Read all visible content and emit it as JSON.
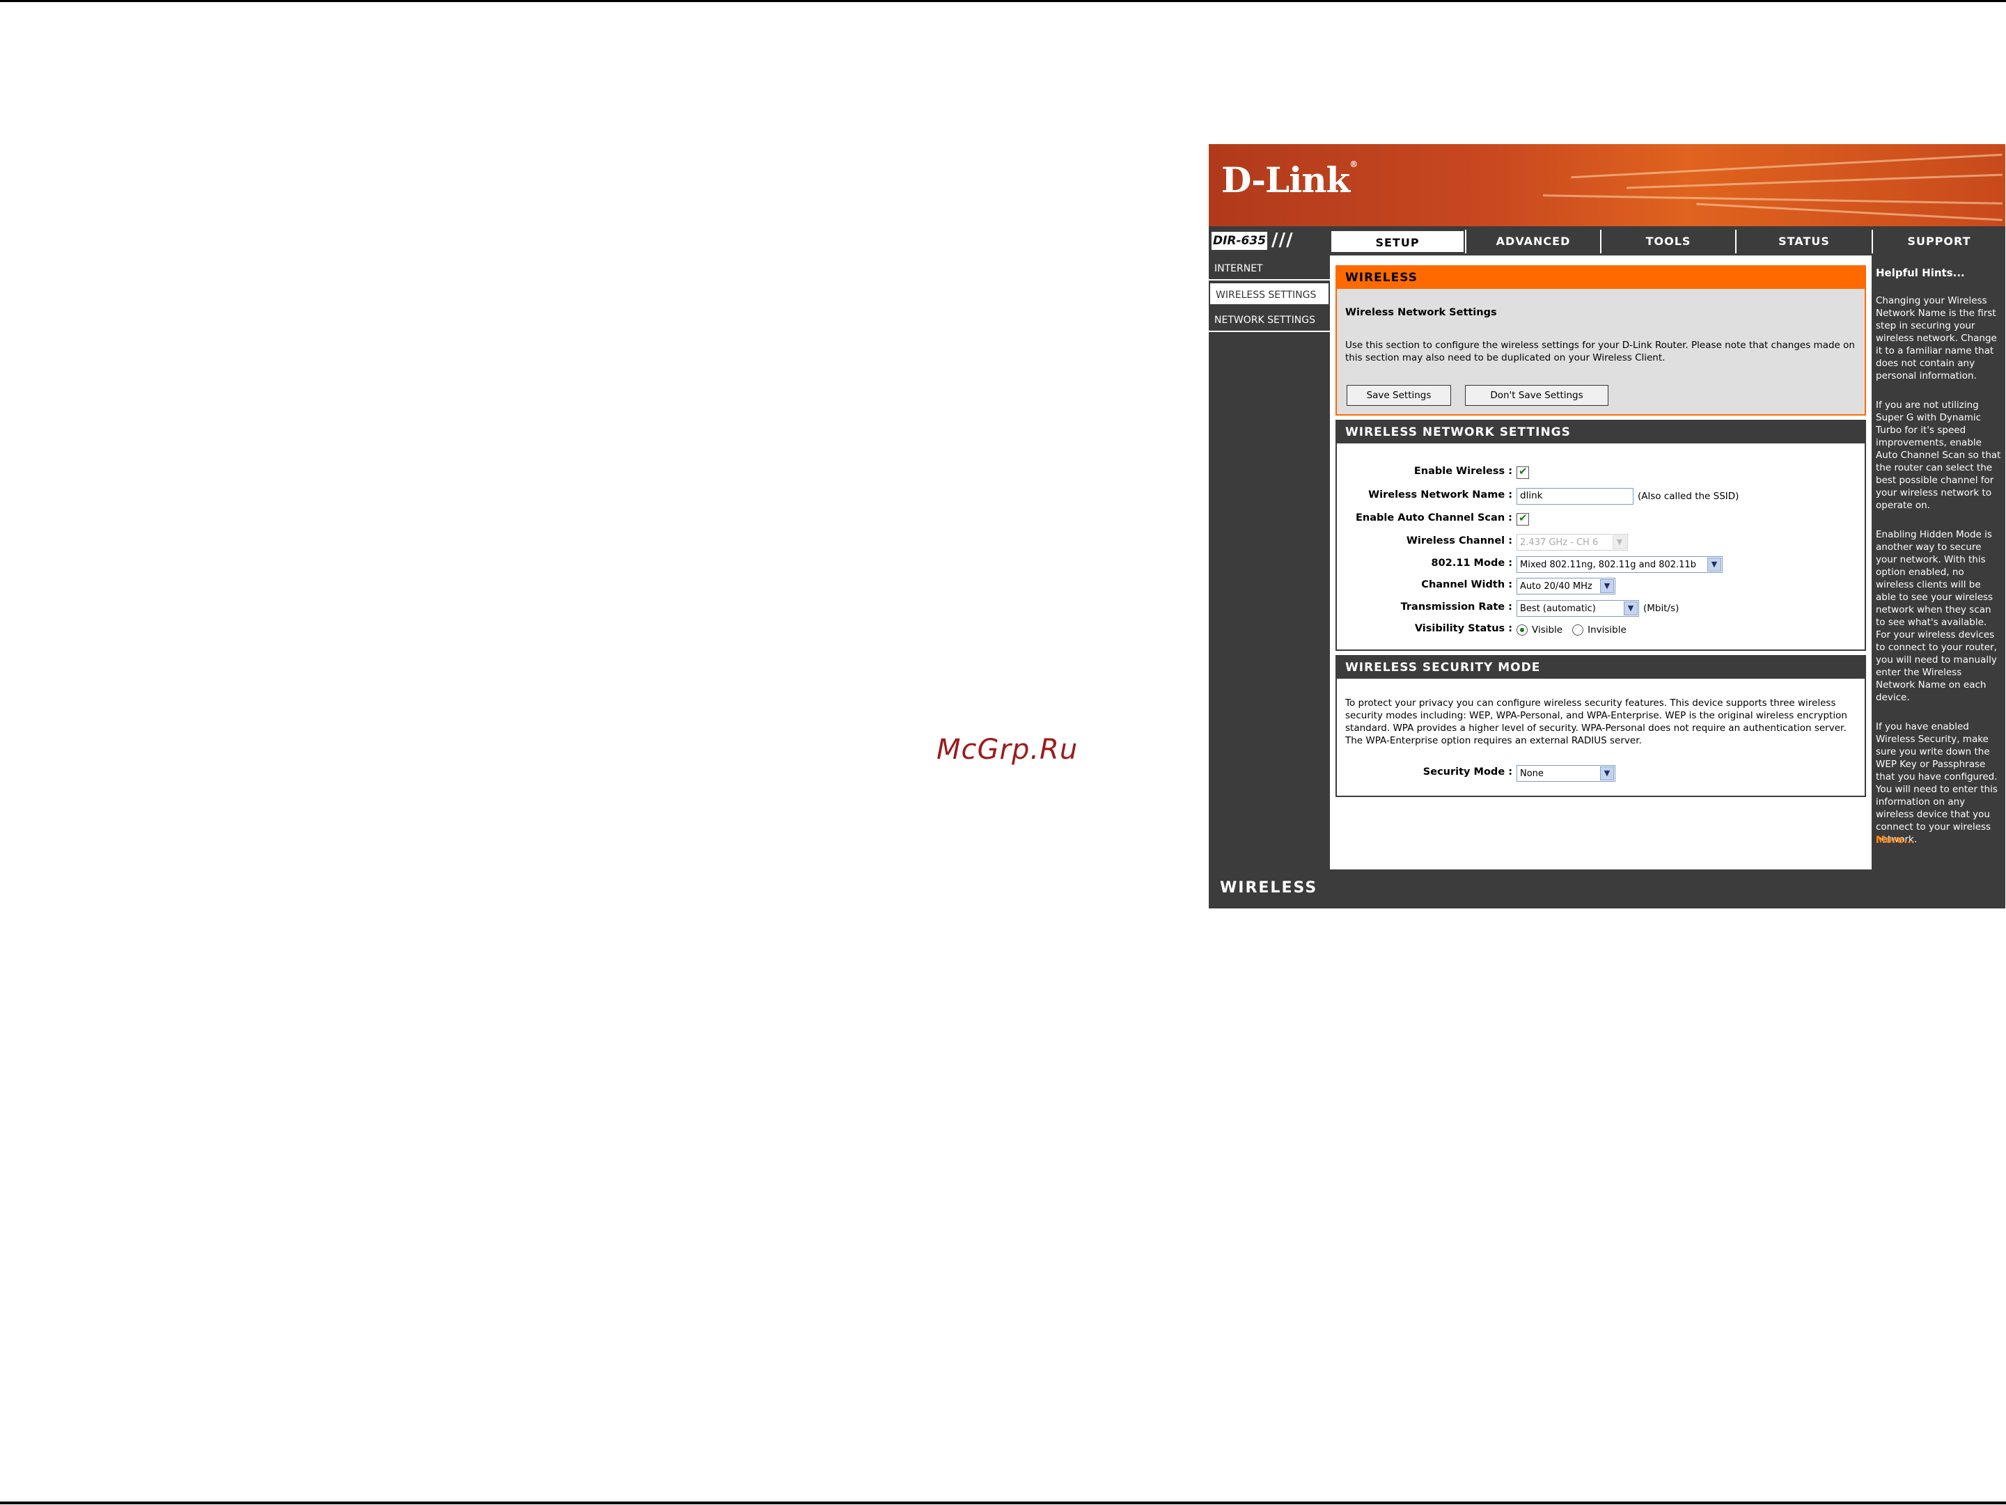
{
  "watermark": "McGrp.Ru",
  "brand": {
    "logo": "D-Link",
    "model": "DIR-635",
    "footer_label": "WIRELESS"
  },
  "tabs": [
    {
      "label": "SETUP",
      "active": true
    },
    {
      "label": "ADVANCED",
      "active": false
    },
    {
      "label": "TOOLS",
      "active": false
    },
    {
      "label": "STATUS",
      "active": false
    },
    {
      "label": "SUPPORT",
      "active": false
    }
  ],
  "sidebar": {
    "items": [
      {
        "label": "INTERNET",
        "active": false
      },
      {
        "label": "WIRELESS SETTINGS",
        "active": true
      },
      {
        "label": "NETWORK SETTINGS",
        "active": false
      }
    ]
  },
  "intro": {
    "header": "WIRELESS",
    "title": "Wireless Network Settings",
    "text": "Use this section to configure the wireless settings for your D-Link Router. Please note that changes made on this section may also need to be duplicated on your Wireless Client.",
    "save_label": "Save Settings",
    "dont_save_label": "Don't Save Settings"
  },
  "wireless_settings": {
    "header": "WIRELESS NETWORK SETTINGS",
    "enable_wireless_label": "Enable Wireless :",
    "enable_wireless": true,
    "network_name_label": "Wireless Network Name :",
    "network_name_value": "dlink",
    "network_name_note": "(Also called the SSID)",
    "auto_channel_label": "Enable Auto Channel Scan :",
    "auto_channel": true,
    "channel_label": "Wireless Channel :",
    "channel_value": "2.437 GHz - CH 6",
    "mode_label": "802.11 Mode :",
    "mode_value": "Mixed 802.11ng, 802.11g and 802.11b",
    "width_label": "Channel Width :",
    "width_value": "Auto 20/40 MHz",
    "rate_label": "Transmission Rate :",
    "rate_value": "Best (automatic)",
    "rate_unit": "(Mbit/s)",
    "visibility_label": "Visibility Status :",
    "visible_label": "Visible",
    "invisible_label": "Invisible",
    "visibility": "Visible"
  },
  "security": {
    "header": "WIRELESS SECURITY MODE",
    "text": "To protect your privacy you can configure wireless security features. This device supports three wireless security modes including: WEP, WPA-Personal, and WPA-Enterprise. WEP is the original wireless encryption standard. WPA provides a higher level of security. WPA-Personal does not require an authentication server. The WPA-Enterprise option requires an external RADIUS server.",
    "mode_label": "Security Mode :",
    "mode_value": "None"
  },
  "hints": {
    "title": "Helpful Hints...",
    "paragraphs": [
      "Changing your Wireless Network Name is the first step in securing your wireless network. Change it to a familiar name that does not contain any personal information.",
      "If you are not utilizing Super G with Dynamic Turbo for it's speed improvements, enable Auto Channel Scan so that the router can select the best possible channel for your wireless network to operate on.",
      "Enabling Hidden Mode is another way to secure your network. With this option enabled, no wireless clients will be able to see your wireless network when they scan to see what's available. For your wireless devices to connect to your router, you will need to manually enter the Wireless Network Name on each device.",
      "If you have enabled Wireless Security, make sure you write down the WEP Key or Passphrase that you have configured. You will need to enter this information on any wireless device that you connect to your wireless network."
    ],
    "more": "More..."
  },
  "colors": {
    "accent": "#ff6a00",
    "dark": "#3c3c3c",
    "banner": "#c8481f"
  }
}
